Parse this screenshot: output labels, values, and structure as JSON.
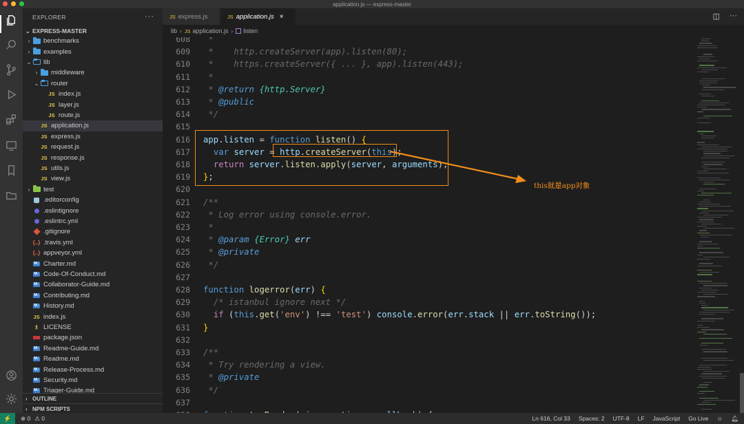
{
  "window": {
    "title": "application.js — express-master"
  },
  "activity_bar": [
    "explorer-icon",
    "search-icon",
    "source-control-icon",
    "run-debug-icon",
    "extensions-icon",
    "remote-explorer-icon",
    "bookmarks-icon",
    "folder-icon",
    "account-icon",
    "settings-gear-icon"
  ],
  "sidebar": {
    "header": "EXPLORER",
    "more": "···",
    "project": "EXPRESS-MASTER",
    "items": [
      {
        "label": "benchmarks",
        "kind": "folder",
        "depth": 1,
        "arrow": "›"
      },
      {
        "label": "examples",
        "kind": "folder",
        "depth": 1,
        "arrow": "›"
      },
      {
        "label": "lib",
        "kind": "folder-open",
        "depth": 1,
        "arrow": "⌄"
      },
      {
        "label": "middleware",
        "kind": "folder",
        "depth": 2,
        "arrow": "›"
      },
      {
        "label": "router",
        "kind": "folder-open",
        "depth": 2,
        "arrow": "⌄"
      },
      {
        "label": "index.js",
        "kind": "js",
        "depth": 3
      },
      {
        "label": "layer.js",
        "kind": "js",
        "depth": 3
      },
      {
        "label": "route.js",
        "kind": "js",
        "depth": 3
      },
      {
        "label": "application.js",
        "kind": "js",
        "depth": 2,
        "selected": true
      },
      {
        "label": "express.js",
        "kind": "js",
        "depth": 2
      },
      {
        "label": "request.js",
        "kind": "js",
        "depth": 2
      },
      {
        "label": "response.js",
        "kind": "js",
        "depth": 2
      },
      {
        "label": "utils.js",
        "kind": "js",
        "depth": 2
      },
      {
        "label": "view.js",
        "kind": "js",
        "depth": 2
      },
      {
        "label": "test",
        "kind": "folder-green",
        "depth": 1,
        "arrow": "›"
      },
      {
        "label": ".editorconfig",
        "kind": "cfg",
        "depth": 1
      },
      {
        "label": ".eslintignore",
        "kind": "dot",
        "depth": 1
      },
      {
        "label": ".eslintrc.yml",
        "kind": "dot",
        "depth": 1
      },
      {
        "label": ".gitignore",
        "kind": "git",
        "depth": 1
      },
      {
        "label": ".travis.yml",
        "kind": "yml",
        "depth": 1
      },
      {
        "label": "appveyor.yml",
        "kind": "yml",
        "depth": 1
      },
      {
        "label": "Charter.md",
        "kind": "md",
        "depth": 1
      },
      {
        "label": "Code-Of-Conduct.md",
        "kind": "md",
        "depth": 1
      },
      {
        "label": "Collaborator-Guide.md",
        "kind": "md",
        "depth": 1
      },
      {
        "label": "Contributing.md",
        "kind": "md",
        "depth": 1
      },
      {
        "label": "History.md",
        "kind": "md",
        "depth": 1
      },
      {
        "label": "index.js",
        "kind": "js",
        "depth": 1
      },
      {
        "label": "LICENSE",
        "kind": "lic",
        "depth": 1
      },
      {
        "label": "package.json",
        "kind": "pkg",
        "depth": 1
      },
      {
        "label": "Readme-Guide.md",
        "kind": "md",
        "depth": 1
      },
      {
        "label": "Readme.md",
        "kind": "md",
        "depth": 1
      },
      {
        "label": "Release-Process.md",
        "kind": "md",
        "depth": 1
      },
      {
        "label": "Security.md",
        "kind": "md",
        "depth": 1
      },
      {
        "label": "Triager-Guide.md",
        "kind": "md",
        "depth": 1
      }
    ],
    "outline": "OUTLINE",
    "npm_scripts": "NPM SCRIPTS"
  },
  "tabs": [
    {
      "label": "express.js",
      "active": false
    },
    {
      "label": "application.js",
      "active": true,
      "close": "×"
    }
  ],
  "breadcrumb": {
    "folder": "lib",
    "file": "application.js",
    "symbol": "listen",
    "sep": "›"
  },
  "code_lines": [
    {
      "n": "608",
      "html": "<span class='c-com'> *</span>"
    },
    {
      "n": "609",
      "html": "<span class='c-com'> *    http.createServer(app).listen(80);</span>"
    },
    {
      "n": "610",
      "html": "<span class='c-com'> *    https.createServer({ ... }, app).listen(443);</span>"
    },
    {
      "n": "611",
      "html": "<span class='c-com'> *</span>"
    },
    {
      "n": "612",
      "html": "<span class='c-com'> * </span><span class='c-tag'>@return</span><span class='c-com'> </span><span class='c-ty-i'>{http.Server}</span>"
    },
    {
      "n": "613",
      "html": "<span class='c-com'> * </span><span class='c-tag'>@public</span>"
    },
    {
      "n": "614",
      "html": "<span class='c-com'> */</span>"
    },
    {
      "n": "615",
      "html": ""
    },
    {
      "n": "616",
      "html": "<span class='c-var'>app</span><span class='c-plain'>.</span><span class='c-var'>listen</span><span class='c-plain'> = </span><span class='c-kw'>function</span><span class='c-plain'> </span><span class='c-fn'>listen</span><span class='c-plain'>() </span><span class='c-bracket'>{</span>"
    },
    {
      "n": "617",
      "html": "<span class='c-plain'>  </span><span class='c-kw'>var</span><span class='c-plain'> </span><span class='c-var'>server</span><span class='c-plain'> = </span><span class='c-var'>http</span><span class='c-plain'>.</span><span class='c-fn'>createServer</span><span class='c-plain'>(</span><span class='c-kw'>this</span><span class='c-plain'>);</span>"
    },
    {
      "n": "618",
      "html": "<span class='c-plain'>  </span><span class='c-ctl'>return</span><span class='c-plain'> </span><span class='c-var'>server</span><span class='c-plain'>.</span><span class='c-fn'>listen</span><span class='c-plain'>.</span><span class='c-fn'>apply</span><span class='c-plain'>(</span><span class='c-var'>server</span><span class='c-plain'>, </span><span class='c-var'>arguments</span><span class='c-plain'>);</span>"
    },
    {
      "n": "619",
      "html": "<span class='c-bracket'>}</span><span class='c-plain'>;</span>"
    },
    {
      "n": "620",
      "html": ""
    },
    {
      "n": "621",
      "html": "<span class='c-com'>/**</span>"
    },
    {
      "n": "622",
      "html": "<span class='c-com'> * Log error using console.error.</span>"
    },
    {
      "n": "623",
      "html": "<span class='c-com'> *</span>"
    },
    {
      "n": "624",
      "html": "<span class='c-com'> * </span><span class='c-tag'>@param</span><span class='c-com'> </span><span class='c-ty-i'>{Error}</span><span class='c-com'> </span><span class='c-var-i'>err</span>"
    },
    {
      "n": "625",
      "html": "<span class='c-com'> * </span><span class='c-tag'>@private</span>"
    },
    {
      "n": "626",
      "html": "<span class='c-com'> */</span>"
    },
    {
      "n": "627",
      "html": ""
    },
    {
      "n": "628",
      "html": "<span class='c-kw'>function</span><span class='c-plain'> </span><span class='c-fn'>logerror</span><span class='c-plain'>(</span><span class='c-var'>err</span><span class='c-plain'>) </span><span class='c-bracket'>{</span>"
    },
    {
      "n": "629",
      "html": "<span class='c-plain'>  </span><span class='c-com'>/* istanbul ignore next */</span>"
    },
    {
      "n": "630",
      "html": "<span class='c-plain'>  </span><span class='c-ctl'>if</span><span class='c-plain'> (</span><span class='c-kw'>this</span><span class='c-plain'>.</span><span class='c-fn'>get</span><span class='c-plain'>(</span><span class='c-str'>'env'</span><span class='c-plain'>) !== </span><span class='c-str'>'test'</span><span class='c-plain'>) </span><span class='c-var'>console</span><span class='c-plain'>.</span><span class='c-fn'>error</span><span class='c-plain'>(</span><span class='c-var'>err</span><span class='c-plain'>.</span><span class='c-var'>stack</span><span class='c-plain'> || </span><span class='c-var'>err</span><span class='c-plain'>.</span><span class='c-fn'>toString</span><span class='c-plain'>());</span>"
    },
    {
      "n": "631",
      "html": "<span class='c-bracket'>}</span>"
    },
    {
      "n": "632",
      "html": ""
    },
    {
      "n": "633",
      "html": "<span class='c-com'>/**</span>"
    },
    {
      "n": "634",
      "html": "<span class='c-com'> * Try rendering a view.</span>"
    },
    {
      "n": "635",
      "html": "<span class='c-com'> * </span><span class='c-tag'>@private</span>"
    },
    {
      "n": "636",
      "html": "<span class='c-com'> */</span>"
    },
    {
      "n": "637",
      "html": ""
    },
    {
      "n": "638",
      "html": "<span class='c-kw'>function</span><span class='c-plain'> </span><span class='c-fn'>tryRender</span><span class='c-plain'>(</span><span class='c-var'>view</span><span class='c-plain'>, </span><span class='c-var'>options</span><span class='c-plain'>, </span><span class='c-var'>callback</span><span class='c-plain'>) {</span>"
    }
  ],
  "annotation": {
    "text": "this就是app对象",
    "color": "#f28d1a"
  },
  "statusbar": {
    "remote": "⚡",
    "errors": "⊗ 0",
    "warnings": "⚠ 0",
    "position": "Ln 616, Col 33",
    "spaces": "Spaces: 2",
    "encoding": "UTF-8",
    "eol": "LF",
    "language": "JavaScript",
    "golive": "Go Live",
    "feedback": "☺",
    "bell": "🔔︎"
  },
  "colors": {
    "accent": "#f28d1a",
    "status_remote": "#16825d"
  }
}
